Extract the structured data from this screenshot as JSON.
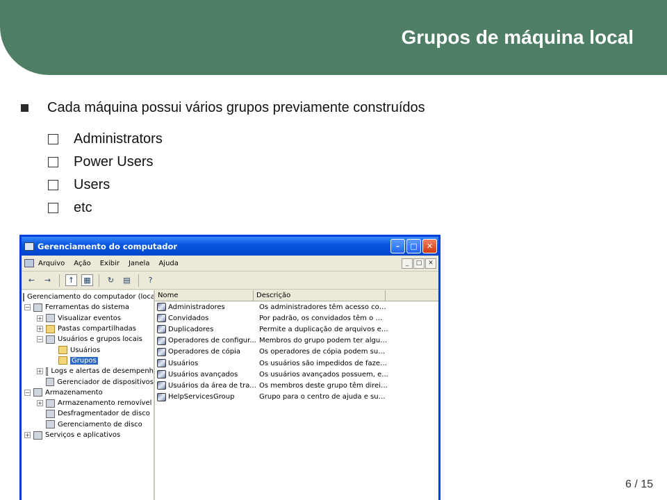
{
  "slide": {
    "title": "Grupos de máquina local",
    "bullet": "Cada máquina possui vários grupos previamente construídos",
    "sub_items": [
      "Administrators",
      "Power Users",
      "Users",
      "etc"
    ],
    "page_number": "6 / 15"
  },
  "window": {
    "title": "Gerenciamento do computador",
    "menu": [
      "Arquivo",
      "Ação",
      "Exibir",
      "Janela",
      "Ajuda"
    ],
    "tree": [
      {
        "label": "Gerenciamento do computador (local"
      },
      {
        "label": "Ferramentas do sistema"
      },
      {
        "label": "Visualizar eventos"
      },
      {
        "label": "Pastas compartilhadas"
      },
      {
        "label": "Usuários e grupos locais"
      },
      {
        "label": "Usuários"
      },
      {
        "label": "Grupos"
      },
      {
        "label": "Logs e alertas de desempenh"
      },
      {
        "label": "Gerenciador de dispositivos"
      },
      {
        "label": "Armazenamento"
      },
      {
        "label": "Armazenamento removível"
      },
      {
        "label": "Desfragmentador de disco"
      },
      {
        "label": "Gerenciamento de disco"
      },
      {
        "label": "Serviços e aplicativos"
      }
    ],
    "columns": {
      "name": "Nome",
      "description": "Descrição"
    },
    "groups": [
      {
        "name": "Administradores",
        "description": "Os administradores têm acesso com..."
      },
      {
        "name": "Convidados",
        "description": "Por padrão, os convidados têm o me..."
      },
      {
        "name": "Duplicadores",
        "description": "Permite a duplicação de arquivos em..."
      },
      {
        "name": "Operadores de configur...",
        "description": "Membros do grupo podem ter alguns..."
      },
      {
        "name": "Operadores de cópia",
        "description": "Os operadores de cópia podem subs..."
      },
      {
        "name": "Usuários",
        "description": "Os usuários são impedidos de fazer ..."
      },
      {
        "name": "Usuários avançados",
        "description": "Os usuários avançados possuem, e..."
      },
      {
        "name": "Usuários da área de tra...",
        "description": "Os membros deste grupo têm direito..."
      },
      {
        "name": "HelpServicesGroup",
        "description": "Grupo para o centro de ajuda e sup..."
      }
    ]
  }
}
